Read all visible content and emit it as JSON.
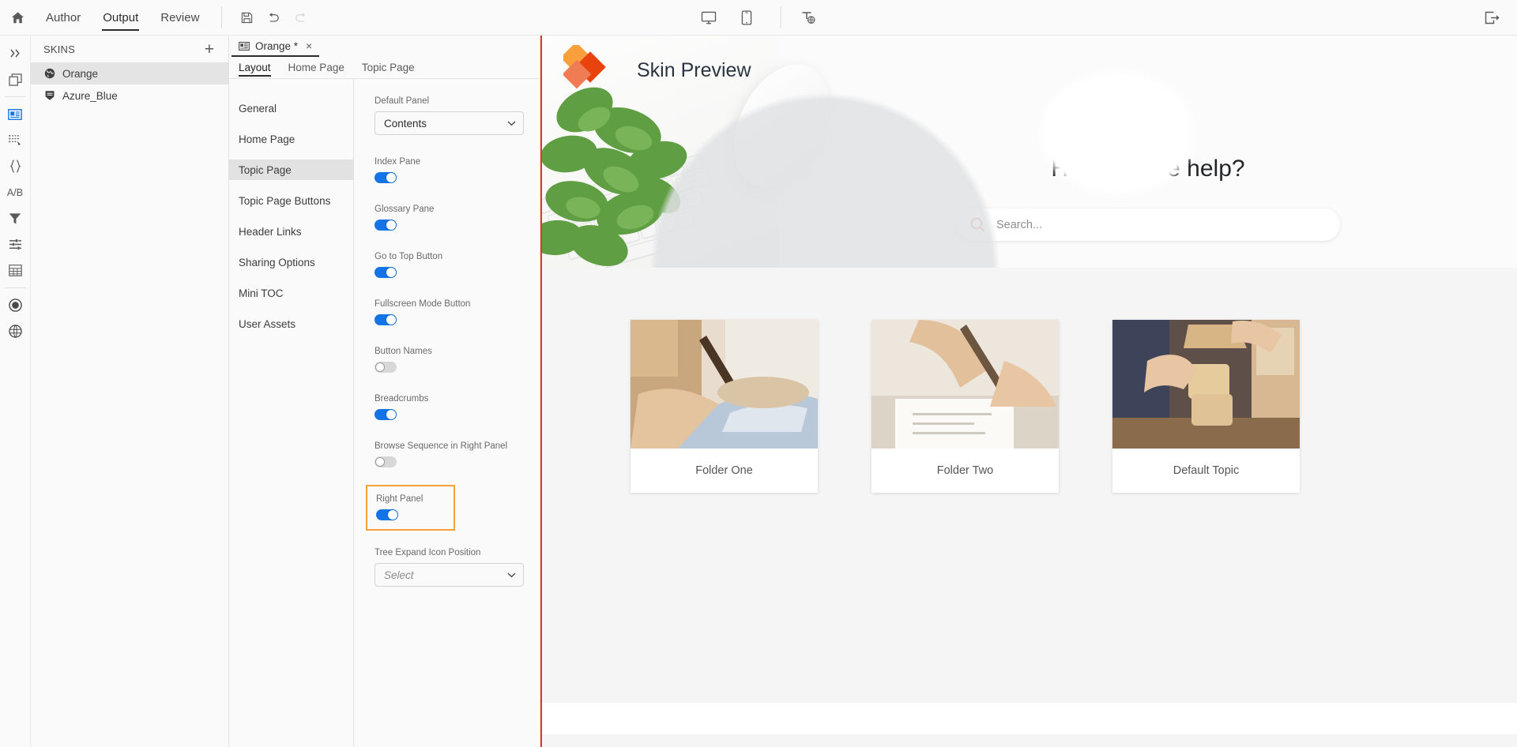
{
  "topbar": {
    "home_icon": "home-icon",
    "menus": [
      {
        "label": "Author",
        "active": false
      },
      {
        "label": "Output",
        "active": true
      },
      {
        "label": "Review",
        "active": false
      }
    ],
    "tools": [
      {
        "name": "save-icon",
        "enabled": true
      },
      {
        "name": "undo-icon",
        "enabled": true
      },
      {
        "name": "redo-icon",
        "enabled": false
      }
    ],
    "center_tools": [
      {
        "name": "desktop-preview-icon"
      },
      {
        "name": "mobile-preview-icon"
      },
      {
        "name": "translate-text-icon"
      }
    ],
    "right_tools": [
      {
        "name": "exit-icon"
      }
    ]
  },
  "rail": {
    "items": [
      {
        "name": "expand-panel-icon",
        "selected": false
      },
      {
        "name": "windows-icon",
        "selected": false
      },
      {
        "name": "skins-icon",
        "selected": true
      },
      {
        "name": "list-tag-icon",
        "selected": false
      },
      {
        "name": "snippets-braces-icon",
        "selected": false
      },
      {
        "name": "variables-ab-icon",
        "selected": false
      },
      {
        "name": "filter-icon",
        "selected": false
      },
      {
        "name": "preset-sliders-icon",
        "selected": false
      },
      {
        "name": "table-icon",
        "selected": false
      },
      {
        "name": "target-circle-icon",
        "selected": false
      },
      {
        "name": "globe-layers-icon",
        "selected": false
      }
    ],
    "ab_label": "A/B"
  },
  "skins_panel": {
    "title": "SKINS",
    "add_label": "+",
    "items": [
      {
        "label": "Orange",
        "icon": "globe-skin-icon",
        "selected": true
      },
      {
        "label": "Azure_Blue",
        "icon": "shield-skin-icon",
        "selected": false
      }
    ]
  },
  "editor": {
    "document_tab": {
      "label": "Orange *",
      "icon": "skin-document-icon",
      "close": "×"
    },
    "subtabs": [
      {
        "label": "Layout",
        "active": true
      },
      {
        "label": "Home Page",
        "active": false
      },
      {
        "label": "Topic Page",
        "active": false
      }
    ],
    "nav_items": [
      {
        "label": "General",
        "selected": false
      },
      {
        "label": "Home Page",
        "selected": false
      },
      {
        "label": "Topic Page",
        "selected": true
      },
      {
        "label": "Topic Page Buttons",
        "selected": false
      },
      {
        "label": "Header Links",
        "selected": false
      },
      {
        "label": "Sharing Options",
        "selected": false
      },
      {
        "label": "Mini TOC",
        "selected": false
      },
      {
        "label": "User Assets",
        "selected": false
      }
    ],
    "fields": [
      {
        "label": "Default Panel",
        "type": "select",
        "value": "Contents",
        "placeholder": false
      },
      {
        "label": "Index Pane",
        "type": "toggle",
        "value": "on"
      },
      {
        "label": "Glossary Pane",
        "type": "toggle",
        "value": "on"
      },
      {
        "label": "Go to Top Button",
        "type": "toggle",
        "value": "on"
      },
      {
        "label": "Fullscreen Mode Button",
        "type": "toggle",
        "value": "on"
      },
      {
        "label": "Button Names",
        "type": "toggle",
        "value": "off"
      },
      {
        "label": "Breadcrumbs",
        "type": "toggle",
        "value": "on"
      },
      {
        "label": "Browse Sequence in Right Panel",
        "type": "toggle",
        "value": "off"
      },
      {
        "label": "Right Panel",
        "type": "toggle",
        "value": "on",
        "highlighted": true
      },
      {
        "label": "Tree Expand Icon Position",
        "type": "select",
        "value": "Select",
        "placeholder": true
      }
    ],
    "highlight_color": "#f5a13c"
  },
  "preview": {
    "border_color": "#ea3323",
    "title": "Skin Preview",
    "help_heading": "How can we help?",
    "search_placeholder": "Search...",
    "search_icon": "search-icon",
    "logo_colors": [
      "#f9a03c",
      "#e8430d",
      "#ef7c52"
    ],
    "cards": [
      {
        "label": "Folder One",
        "image": "woman-writing-laptop"
      },
      {
        "label": "Folder Two",
        "image": "hand-pen-document"
      },
      {
        "label": "Default Topic",
        "image": "hands-wooden-blocks"
      }
    ]
  }
}
